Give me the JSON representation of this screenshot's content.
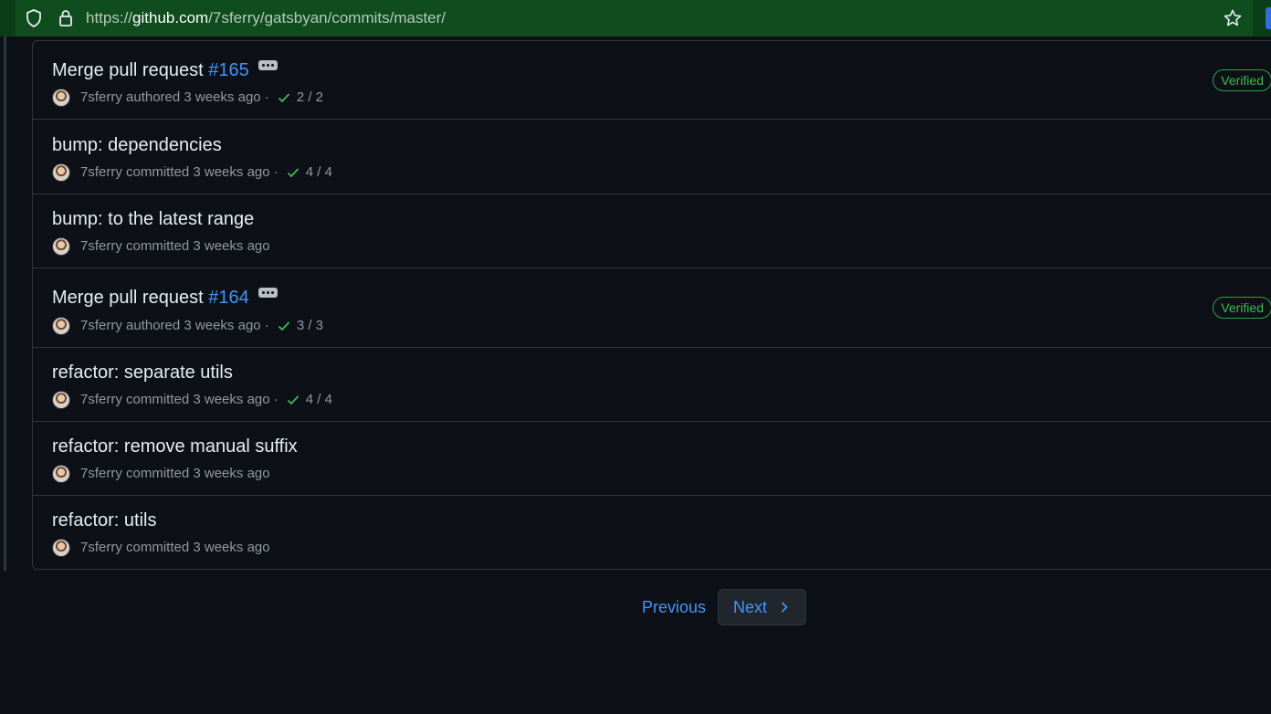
{
  "browser": {
    "url_host": "github.com",
    "url_prefix": "https://",
    "url_path": "/7sferry/gatsbyan/commits/master/",
    "icons": [
      "shield-icon",
      "lock-icon",
      "star-icon"
    ]
  },
  "commits": [
    {
      "message": "Merge pull request ",
      "pr": "#165",
      "author": "7sferry",
      "action": "authored",
      "time": "3 weeks ago",
      "checks": "2 / 2",
      "verified": "Verified"
    },
    {
      "message": "bump: dependencies",
      "author": "7sferry",
      "action": "committed",
      "time": "3 weeks ago",
      "checks": "4 / 4"
    },
    {
      "message": "bump: to the latest range",
      "author": "7sferry",
      "action": "committed",
      "time": "3 weeks ago"
    },
    {
      "message": "Merge pull request ",
      "pr": "#164",
      "author": "7sferry",
      "action": "authored",
      "time": "3 weeks ago",
      "checks": "3 / 3",
      "verified": "Verified"
    },
    {
      "message": "refactor: separate utils",
      "author": "7sferry",
      "action": "committed",
      "time": "3 weeks ago",
      "checks": "4 / 4"
    },
    {
      "message": "refactor: remove manual suffix",
      "author": "7sferry",
      "action": "committed",
      "time": "3 weeks ago"
    },
    {
      "message": "refactor: utils",
      "author": "7sferry",
      "action": "committed",
      "time": "3 weeks ago"
    }
  ],
  "pagination": {
    "previous_label": "Previous",
    "next_label": "Next"
  },
  "colors": {
    "background": "#0d1117",
    "link": "#4493f8",
    "verified": "#3fb950",
    "check": "#3fb950"
  }
}
